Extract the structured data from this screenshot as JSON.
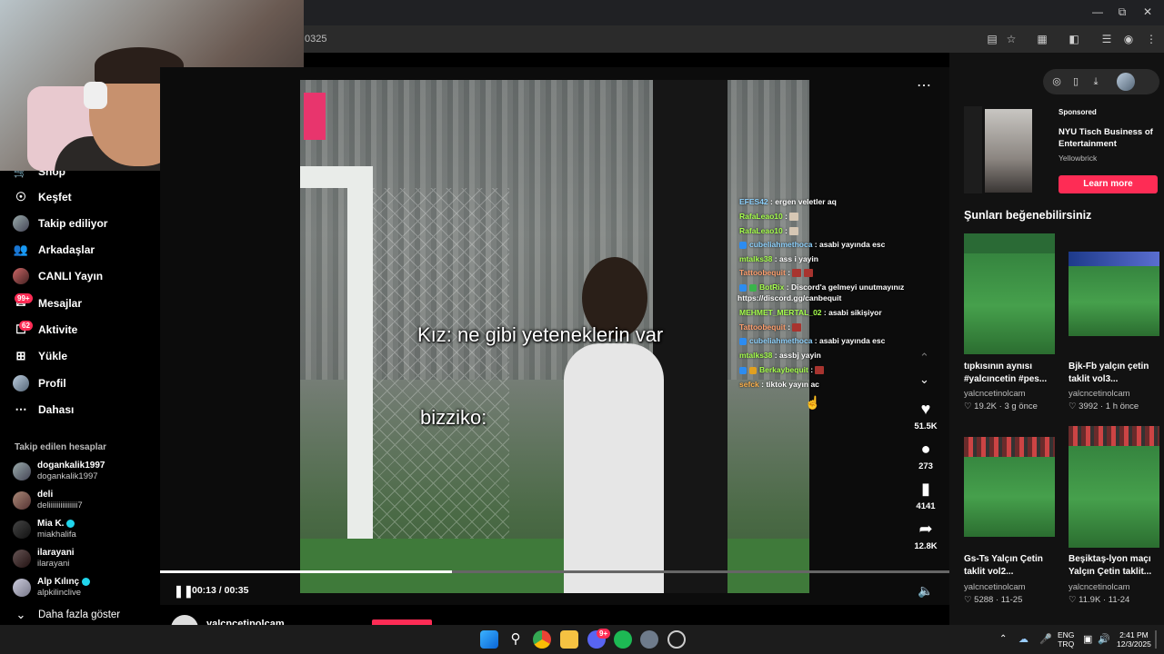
{
  "browser": {
    "url": "0325"
  },
  "sidebar": {
    "items": [
      {
        "label": "Shop",
        "icon": "shop-icon"
      },
      {
        "label": "Keşfet",
        "icon": "compass-icon"
      },
      {
        "label": "Takip ediliyor",
        "icon": "following-avatar-icon"
      },
      {
        "label": "Arkadaşlar",
        "icon": "friends-icon"
      },
      {
        "label": "CANLI Yayın",
        "icon": "live-icon"
      },
      {
        "label": "Mesajlar",
        "icon": "messages-icon",
        "badge": "99+"
      },
      {
        "label": "Aktivite",
        "icon": "activity-icon",
        "badge": "62"
      },
      {
        "label": "Yükle",
        "icon": "upload-icon"
      },
      {
        "label": "Profil",
        "icon": "profile-avatar-icon"
      },
      {
        "label": "Dahası",
        "icon": "more-icon"
      }
    ],
    "following_title": "Takip edilen hesaplar",
    "accounts": [
      {
        "name": "dogankalik1997",
        "handle": "dogankalik1997",
        "verified": false
      },
      {
        "name": "deli",
        "handle": "deliiiiiiiiiiiiiii7",
        "verified": false
      },
      {
        "name": "Mia K.",
        "handle": "miakhalifa",
        "verified": true
      },
      {
        "name": "ilarayani",
        "handle": "ilarayani",
        "verified": false
      },
      {
        "name": "Alp Kılınç",
        "handle": "alpkilinclive",
        "verified": true
      }
    ],
    "show_more": "Daha fazla göster"
  },
  "video": {
    "caption1": "Kız: ne gibi yeteneklerin var",
    "caption2": "bizziko:",
    "time": "00:13 / 00:35",
    "progress": 0.37,
    "author_partial": "yalcncetinolcam"
  },
  "chat": [
    {
      "user": "EFES42",
      "color": "#8fd3ff",
      "msg": "ergen veletler aq"
    },
    {
      "user": "RafaLeao10",
      "color": "#a6ff4d",
      "msg": "",
      "emotes": [
        "plain"
      ]
    },
    {
      "user": "RafaLeao10",
      "color": "#a6ff4d",
      "msg": "",
      "emotes": [
        "plain"
      ]
    },
    {
      "user": "cubeliahmethoca",
      "color": "#8fd3ff",
      "msg": "asabi yayında esc",
      "tag": true
    },
    {
      "user": "mtalks38",
      "color": "#a6ff4d",
      "msg": "ass i yayin"
    },
    {
      "user": "Tattoobequit",
      "color": "#ff9f6e",
      "msg": "",
      "emotes": [
        "red",
        "red"
      ]
    },
    {
      "user": "BotRix",
      "color": "#a6ff4d",
      "msg": "Discord'a gelmeyi unutmayınız",
      "tag": true
    },
    {
      "user": "",
      "color": "#ffffff",
      "msg": "https://discord.gg/canbequit"
    },
    {
      "user": "MEHMET_MERTAL_02",
      "color": "#a6ff4d",
      "msg": "asabi sikişiyor"
    },
    {
      "user": "Tattoobequit",
      "color": "#ff9f6e",
      "msg": "",
      "emotes": [
        "red"
      ]
    },
    {
      "user": "cubeliahmethoca",
      "color": "#8fd3ff",
      "msg": "asabi yayında esc",
      "tag": true
    },
    {
      "user": "mtalks38",
      "color": "#a6ff4d",
      "msg": "assbj yayin"
    },
    {
      "user": "Berkaybequit",
      "color": "#a6ff4d",
      "msg": "",
      "emotes": [
        "red"
      ],
      "tag": true
    },
    {
      "user": "sefck",
      "color": "#ffb24d",
      "msg": "tiktok yayın ac"
    }
  ],
  "actions": {
    "likes": "51.5K",
    "comments": "273",
    "saves": "4141",
    "shares": "12.8K"
  },
  "ad": {
    "sponsored": "Sponsored",
    "title": "NYU Tisch Business of Entertainment",
    "brand": "Yellowbrick",
    "cta": "Learn more"
  },
  "recommend": {
    "heading": "Şunları beğenebilirsiniz",
    "cards": [
      {
        "title": "tıpkısının aynısı #yalcıncetin #pes...",
        "author": "yalcncetinolcam",
        "likes": "19.2K",
        "age": "3 g önce"
      },
      {
        "title": "Bjk-Fb yalçın çetin taklit vol3...",
        "author": "yalcncetinolcam",
        "likes": "3992",
        "age": "1 h önce"
      },
      {
        "title": "Gs-Ts Yalçın Çetin taklit vol2...",
        "author": "yalcncetinolcam",
        "likes": "5288",
        "age": "11-25"
      },
      {
        "title": "Beşiktaş-lyon maçı Yalçın Çetin taklit...",
        "author": "yalcncetinolcam",
        "likes": "11.9K",
        "age": "11-24"
      }
    ]
  },
  "taskbar": {
    "lang1": "ENG",
    "lang2": "TRQ",
    "time": "2:41 PM",
    "date": "12/3/2025",
    "discord_badge": "9+"
  }
}
